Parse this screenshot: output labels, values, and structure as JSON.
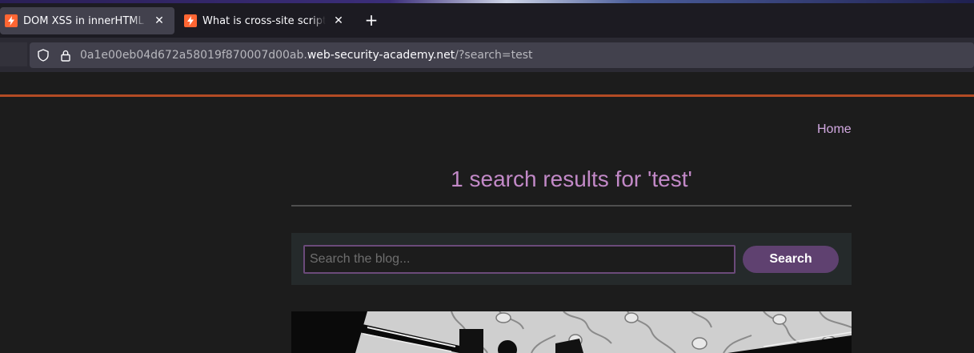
{
  "browser": {
    "tabs": [
      {
        "title": "DOM XSS in innerHTML sink using source location.search",
        "active": true
      },
      {
        "title": "What is cross-site scripting (XSS) and how to prevent it?",
        "active": false
      }
    ],
    "close_glyph": "✕",
    "new_tab_glyph": "+",
    "url": {
      "prefix": "0a1e00eb04d672a58019f870007d00ab.",
      "domain": "web-security-academy.net",
      "suffix": "/?search=test"
    },
    "favicon_color": "#ff6633"
  },
  "site": {
    "nav": {
      "home_label": "Home"
    },
    "heading": "1 search results for 'test'",
    "search": {
      "placeholder": "Search the blog...",
      "button_label": "Search"
    }
  },
  "colors": {
    "accent_line": "#b34b24",
    "heading": "#c289c7",
    "home_link": "#d1a8e0",
    "button": "#5f4170"
  }
}
